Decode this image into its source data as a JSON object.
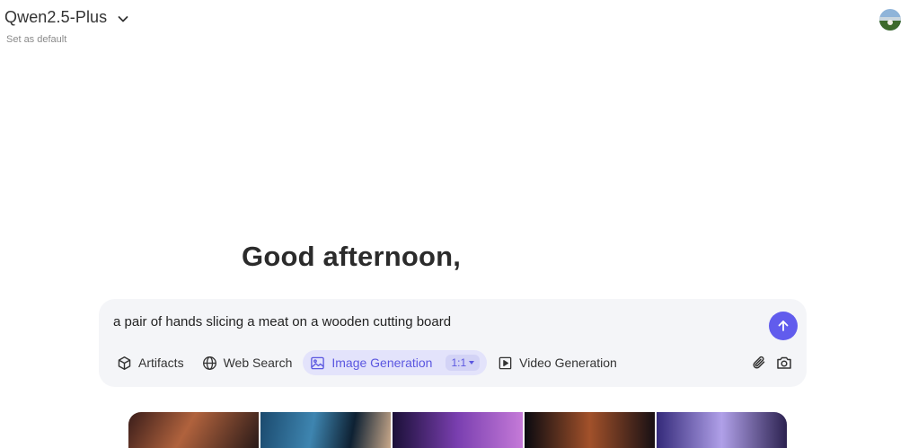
{
  "header": {
    "model_name": "Qwen2.5-Plus",
    "set_default_label": "Set as default"
  },
  "greeting": "Good afternoon,",
  "composer": {
    "input_value": "a pair of hands slicing a meat on a wooden cutting board",
    "tools": {
      "artifacts": "Artifacts",
      "web_search": "Web Search",
      "image_generation": "Image Generation",
      "aspect_ratio": "1:1",
      "video_generation": "Video Generation"
    },
    "active_tool": "image_generation"
  },
  "colors": {
    "accent": "#615ced",
    "active_tool_bg": "#e3e3fb",
    "composer_bg": "#f4f5f8"
  },
  "icons": [
    "chevron-down-icon",
    "avatar",
    "cube-icon",
    "globe-icon",
    "image-icon",
    "video-play-icon",
    "paperclip-icon",
    "camera-icon",
    "arrow-up-icon"
  ]
}
